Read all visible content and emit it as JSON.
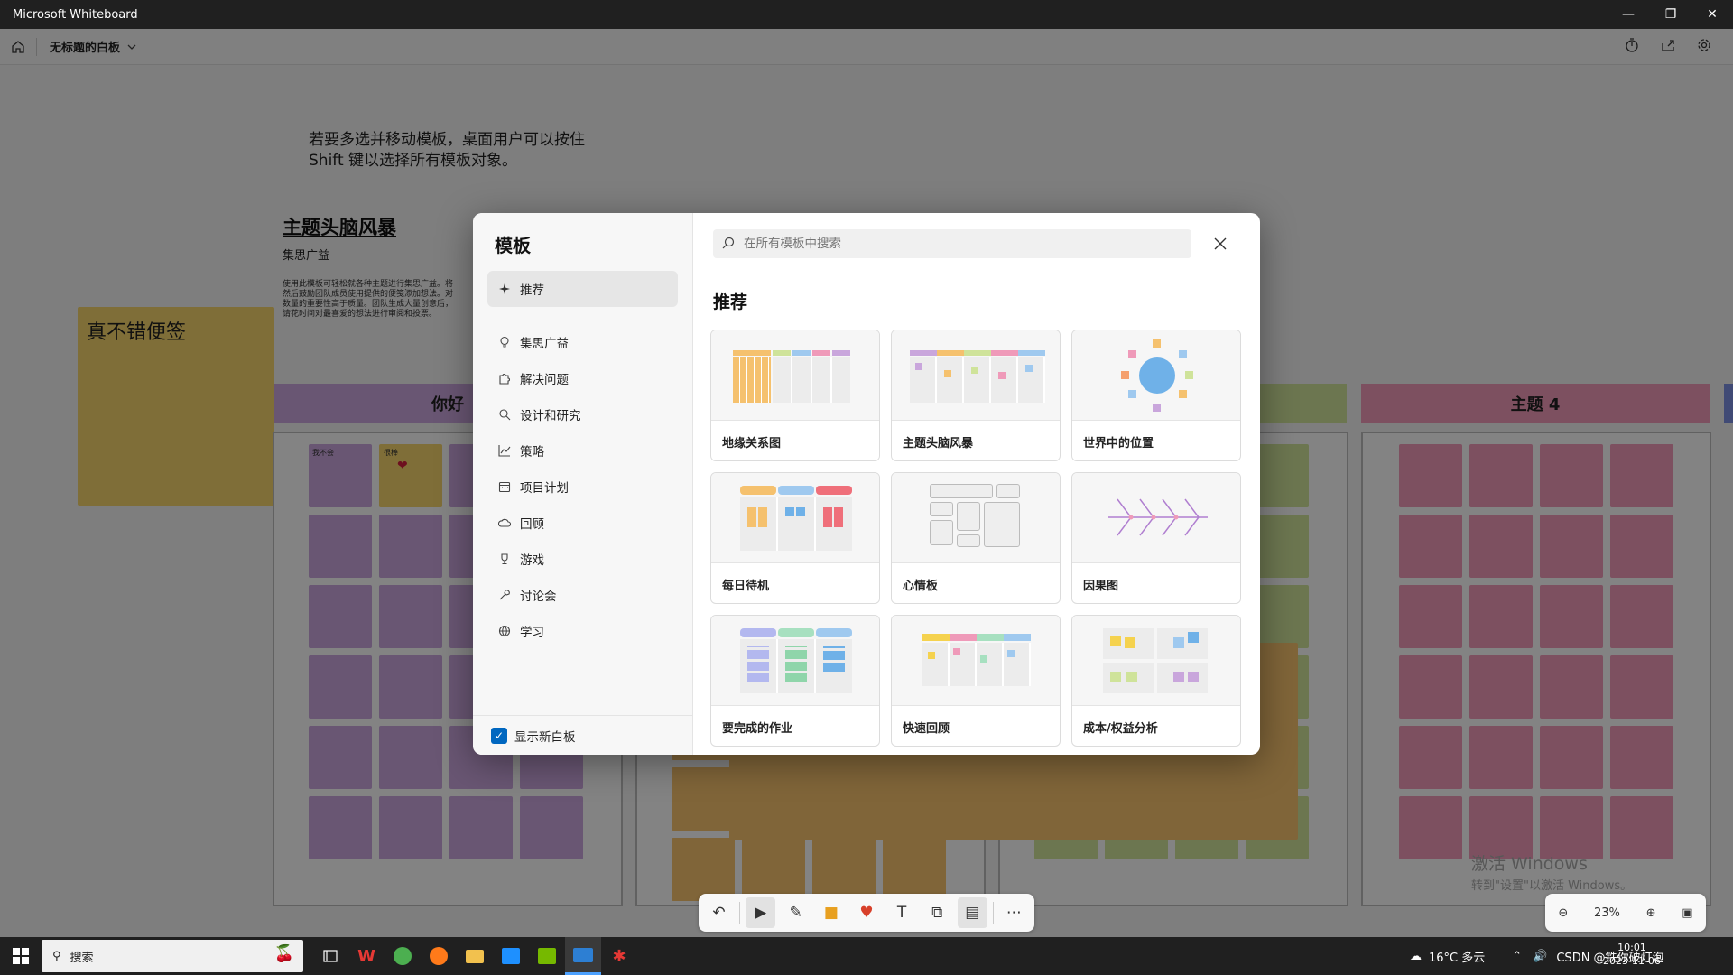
{
  "window": {
    "title": "Microsoft Whiteboard"
  },
  "appbar": {
    "board_title": "无标题的白板"
  },
  "canvas": {
    "hint_line1": "若要多选并移动模板，桌面用户可以按住",
    "hint_line2": "Shift 键以选择所有模板对象。",
    "brainstorm_title": "主题头脑风暴",
    "brainstorm_subtitle": "集思广益",
    "brainstorm_desc_1": "使用此模板可轻松就各种主题进行集思广益。将",
    "brainstorm_desc_2": "然后鼓励团队成员使用提供的便笺添加想法。对",
    "brainstorm_desc_3": "数量的重要性高于质量。团队生成大量创意后，",
    "brainstorm_desc_4": "请花时间对最喜爱的想法进行审阅和投票。",
    "sticky_text": "真不错便签",
    "col1_title": "你好",
    "col4_title": "主题 4",
    "small_note1": "我不会",
    "small_note2": "很棒"
  },
  "dialog": {
    "title": "模板",
    "search_placeholder": "在所有模板中搜索",
    "section_title": "推荐",
    "categories": [
      {
        "label": "推荐",
        "icon": "sparkle-icon"
      },
      {
        "label": "集思广益",
        "icon": "lightbulb-icon"
      },
      {
        "label": "解决问题",
        "icon": "puzzle-icon"
      },
      {
        "label": "设计和研究",
        "icon": "search-icon"
      },
      {
        "label": "策略",
        "icon": "chart-line-icon"
      },
      {
        "label": "项目计划",
        "icon": "calendar-icon"
      },
      {
        "label": "回顾",
        "icon": "cloud-icon"
      },
      {
        "label": "游戏",
        "icon": "trophy-icon"
      },
      {
        "label": "讨论会",
        "icon": "wrench-icon"
      },
      {
        "label": "学习",
        "icon": "globe-icon"
      }
    ],
    "templates": [
      {
        "label": "地缘关系图"
      },
      {
        "label": "主题头脑风暴"
      },
      {
        "label": "世界中的位置"
      },
      {
        "label": "每日待机"
      },
      {
        "label": "心情板"
      },
      {
        "label": "因果图"
      },
      {
        "label": "要完成的作业"
      },
      {
        "label": "快速回顾"
      },
      {
        "label": "成本/权益分析"
      }
    ],
    "show_new_board_label": "显示新白板",
    "show_new_board_checked": true
  },
  "zoom": {
    "level": "23%"
  },
  "taskbar": {
    "search_label": "搜索",
    "weather": "16°C 多云",
    "time": "10:01",
    "date": "2023-11-06",
    "watermark_line1": "激活 Windows",
    "watermark_line2": "转到\"设置\"以激活 Windows。",
    "overlay_text": "CSDN @铁你破灯泡"
  },
  "colors": {
    "accent": "#0067c0",
    "purple_note": "#c9a6dc",
    "yellow_note": "#f3d36b",
    "pink_note": "#ef9ab9",
    "green_note": "#cfe39a",
    "orange_note": "#f5c16e"
  }
}
